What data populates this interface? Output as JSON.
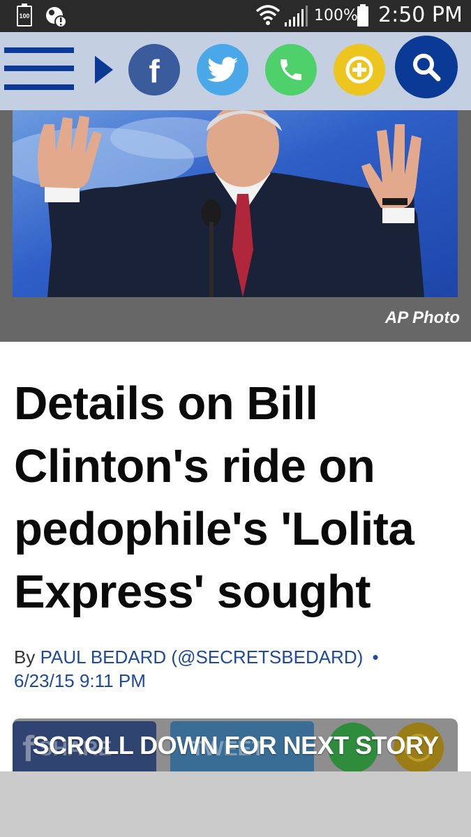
{
  "status_bar": {
    "left_battery_label": "100",
    "battery_percent": "100%",
    "time": "2:50 PM"
  },
  "nav": {
    "icons": [
      "menu-icon",
      "chevron-right-icon",
      "facebook-icon",
      "twitter-icon",
      "phone-icon",
      "plus-icon",
      "search-icon"
    ],
    "facebook_letter": "f",
    "colors": {
      "nav_bg": "#c4cfe1",
      "brand_blue": "#0a3a96",
      "facebook": "#3b5c9c",
      "twitter": "#4aa8e8",
      "phone": "#4ed16a",
      "plus": "#ecc61e"
    }
  },
  "hero": {
    "caption": "AP Photo"
  },
  "article": {
    "headline": "Details on Bill Clinton's ride on pedophile's 'Lolita Express' sought",
    "byline_prefix": "By",
    "author": "PAUL BEDARD (@SECRETSBEDARD)",
    "separator": "•",
    "timestamp": "6/23/15 9:11 PM"
  },
  "share_bar": {
    "facebook_mark": "f",
    "share_label": "SHARE",
    "tweet_label": "TWEET",
    "overlay_text": "SCROLL DOWN FOR NEXT STORY"
  }
}
